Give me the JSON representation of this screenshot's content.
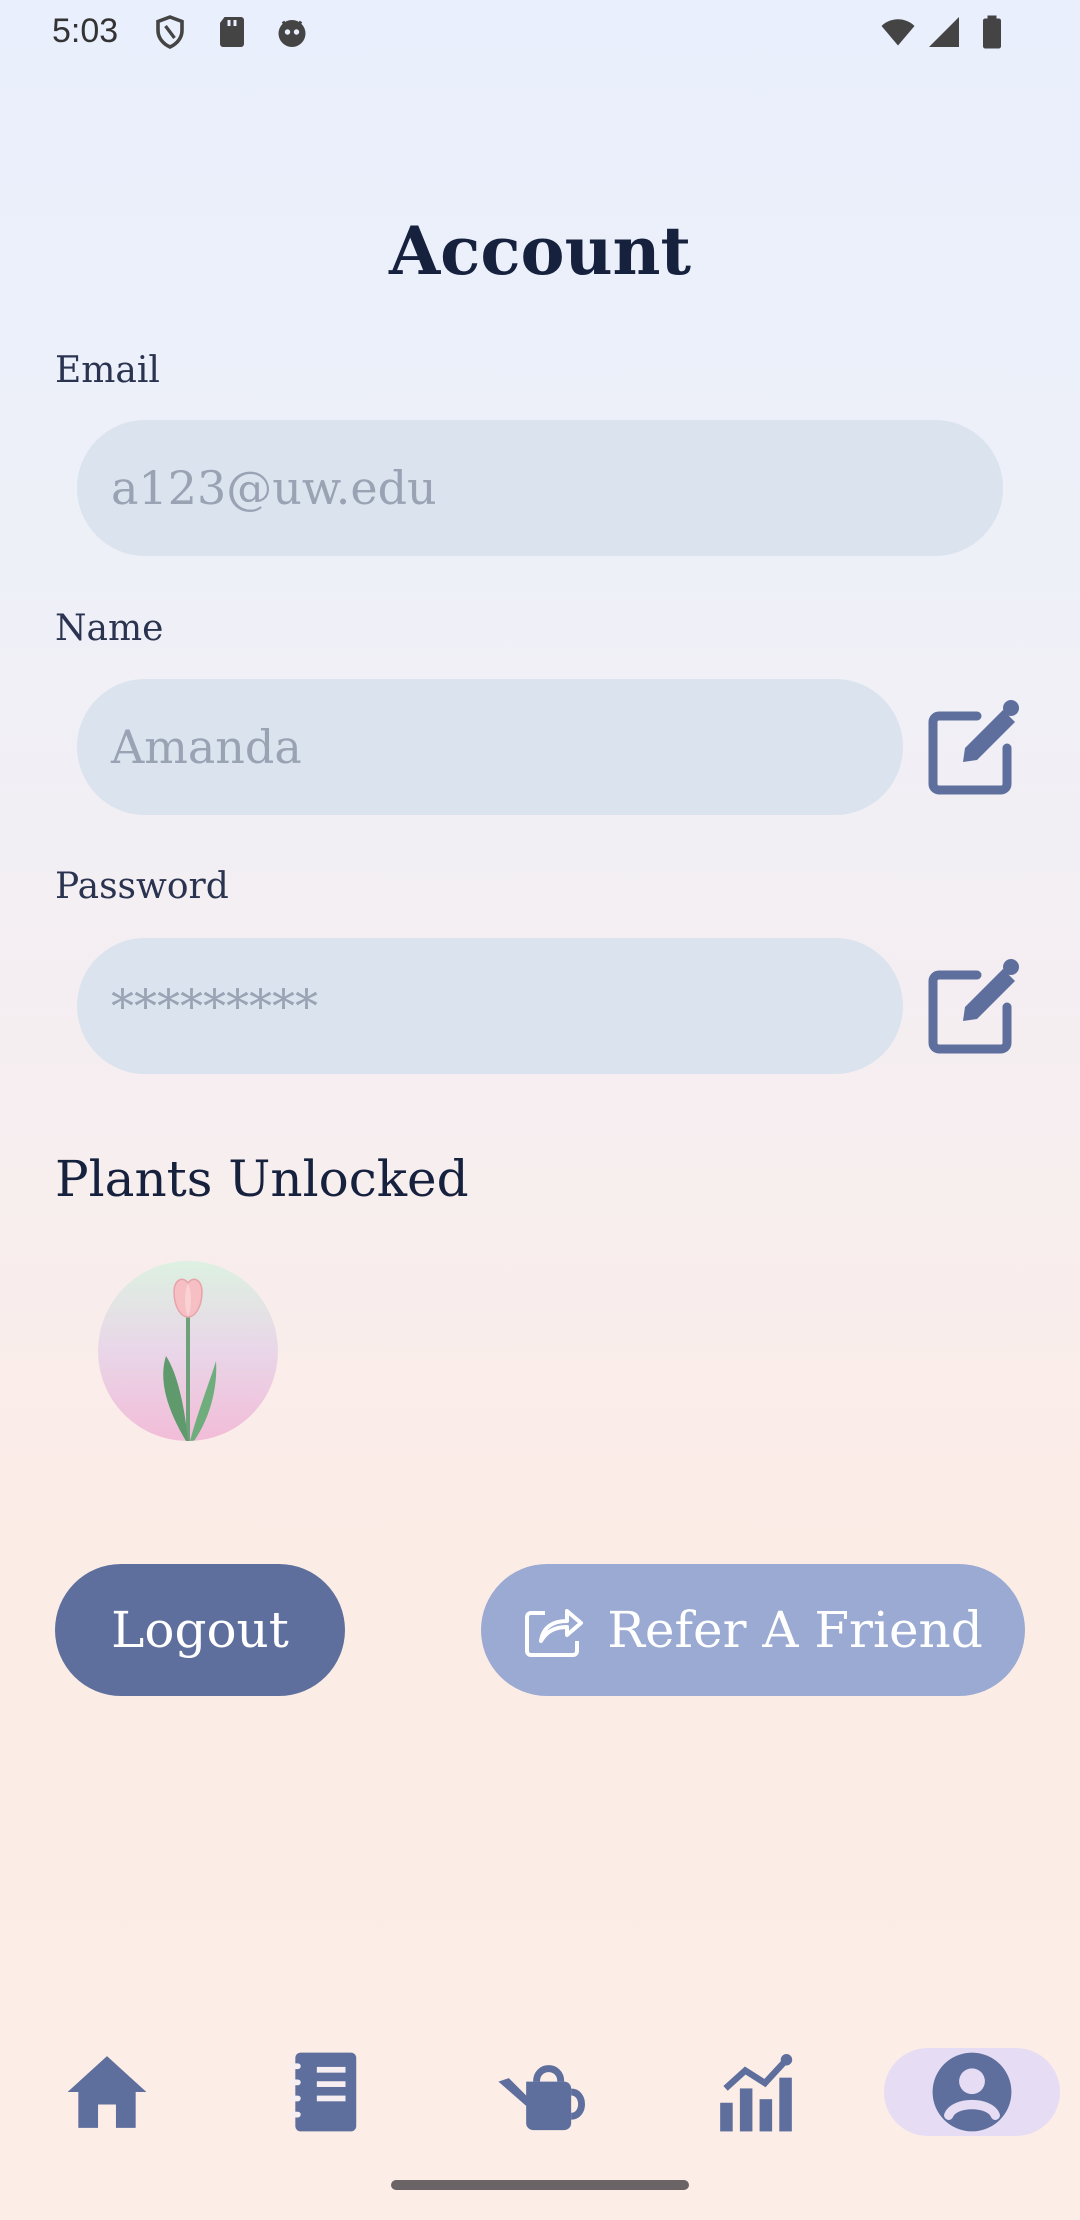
{
  "status_bar": {
    "time": "5:03"
  },
  "page": {
    "title": "Account"
  },
  "email": {
    "label": "Email",
    "value": "a123@uw.edu"
  },
  "name": {
    "label": "Name",
    "value": "Amanda"
  },
  "password": {
    "label": "Password",
    "value": "*********"
  },
  "plants": {
    "title": "Plants Unlocked"
  },
  "buttons": {
    "logout": "Logout",
    "refer": "Refer A Friend"
  },
  "colors": {
    "accent": "#5E6F9E",
    "refer_bg": "#9AAAD2",
    "input_bg": "#DAE3EE",
    "nav_active": "#E6DDF4"
  },
  "nav": {
    "items": [
      {
        "icon": "home-icon"
      },
      {
        "icon": "journal-icon"
      },
      {
        "icon": "watering-can-icon"
      },
      {
        "icon": "stats-icon"
      },
      {
        "icon": "account-icon",
        "active": true
      }
    ]
  }
}
